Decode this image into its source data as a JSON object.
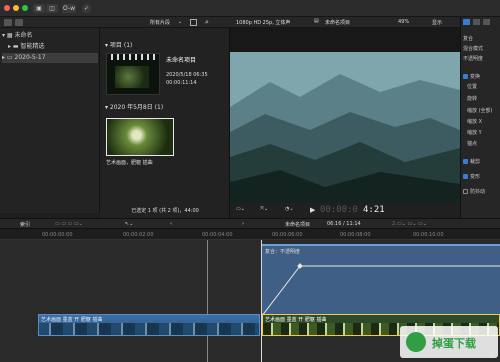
{
  "toolbar": {
    "key_icon_label": "O-w",
    "check_icon_label": "✓"
  },
  "library": {
    "name": "未命名",
    "items": [
      {
        "label": "智能精选"
      },
      {
        "label": "2020-5-17"
      }
    ]
  },
  "browser": {
    "filter_label": "所有片段",
    "project_section": "项目",
    "project_count": "(1)",
    "project_name": "未命名项目",
    "project_date": "2020/5/18 06:35",
    "project_duration": "00:00:11:14",
    "date_section": "2020 年5月8日",
    "date_count": "(1)",
    "clip_caption": "艺术画面，肥躯 插曲",
    "status": "已选定 1 项 (共 2 项)，44:00"
  },
  "viewer": {
    "format": "1080p HD 25p, 立体声",
    "project_title": "未命名项目",
    "zoom": "49%",
    "display_label": "显示",
    "timecode_dim": "00:00:0",
    "timecode_main": "4:21"
  },
  "inspector": {
    "rows": [
      {
        "label": "复合",
        "check": null
      },
      {
        "label": "混合模式",
        "check": null
      },
      {
        "label": "不透明度",
        "check": null
      },
      {
        "label": "变换",
        "check": true
      },
      {
        "label": "位置",
        "check": null
      },
      {
        "label": "旋转",
        "check": null
      },
      {
        "label": "缩放 (全部)",
        "check": null
      },
      {
        "label": "缩放 X",
        "check": null
      },
      {
        "label": "缩放 Y",
        "check": null
      },
      {
        "label": "锚点",
        "check": null
      },
      {
        "label": "裁剪",
        "check": true
      },
      {
        "label": "变形",
        "check": true
      },
      {
        "label": "防抖动",
        "check": false
      }
    ]
  },
  "timeline": {
    "index_label": "索引",
    "project_title": "未命名项目",
    "position": "06:16 / 11:14",
    "ruler_marks": [
      "00:00:00:00",
      "00:00:02:00",
      "00:00:04:00",
      "00:00:06:00",
      "00:00:08:00",
      "00:00:10:00"
    ],
    "effect_label": "复合：不透明度",
    "clip_label_left": "艺术画面 墨蓝 开 肥躯 插曲",
    "clip_label_right": "艺术画面 墨蓝 开 肥躯 插曲"
  },
  "watermark": {
    "text": "掉蛋下载"
  }
}
